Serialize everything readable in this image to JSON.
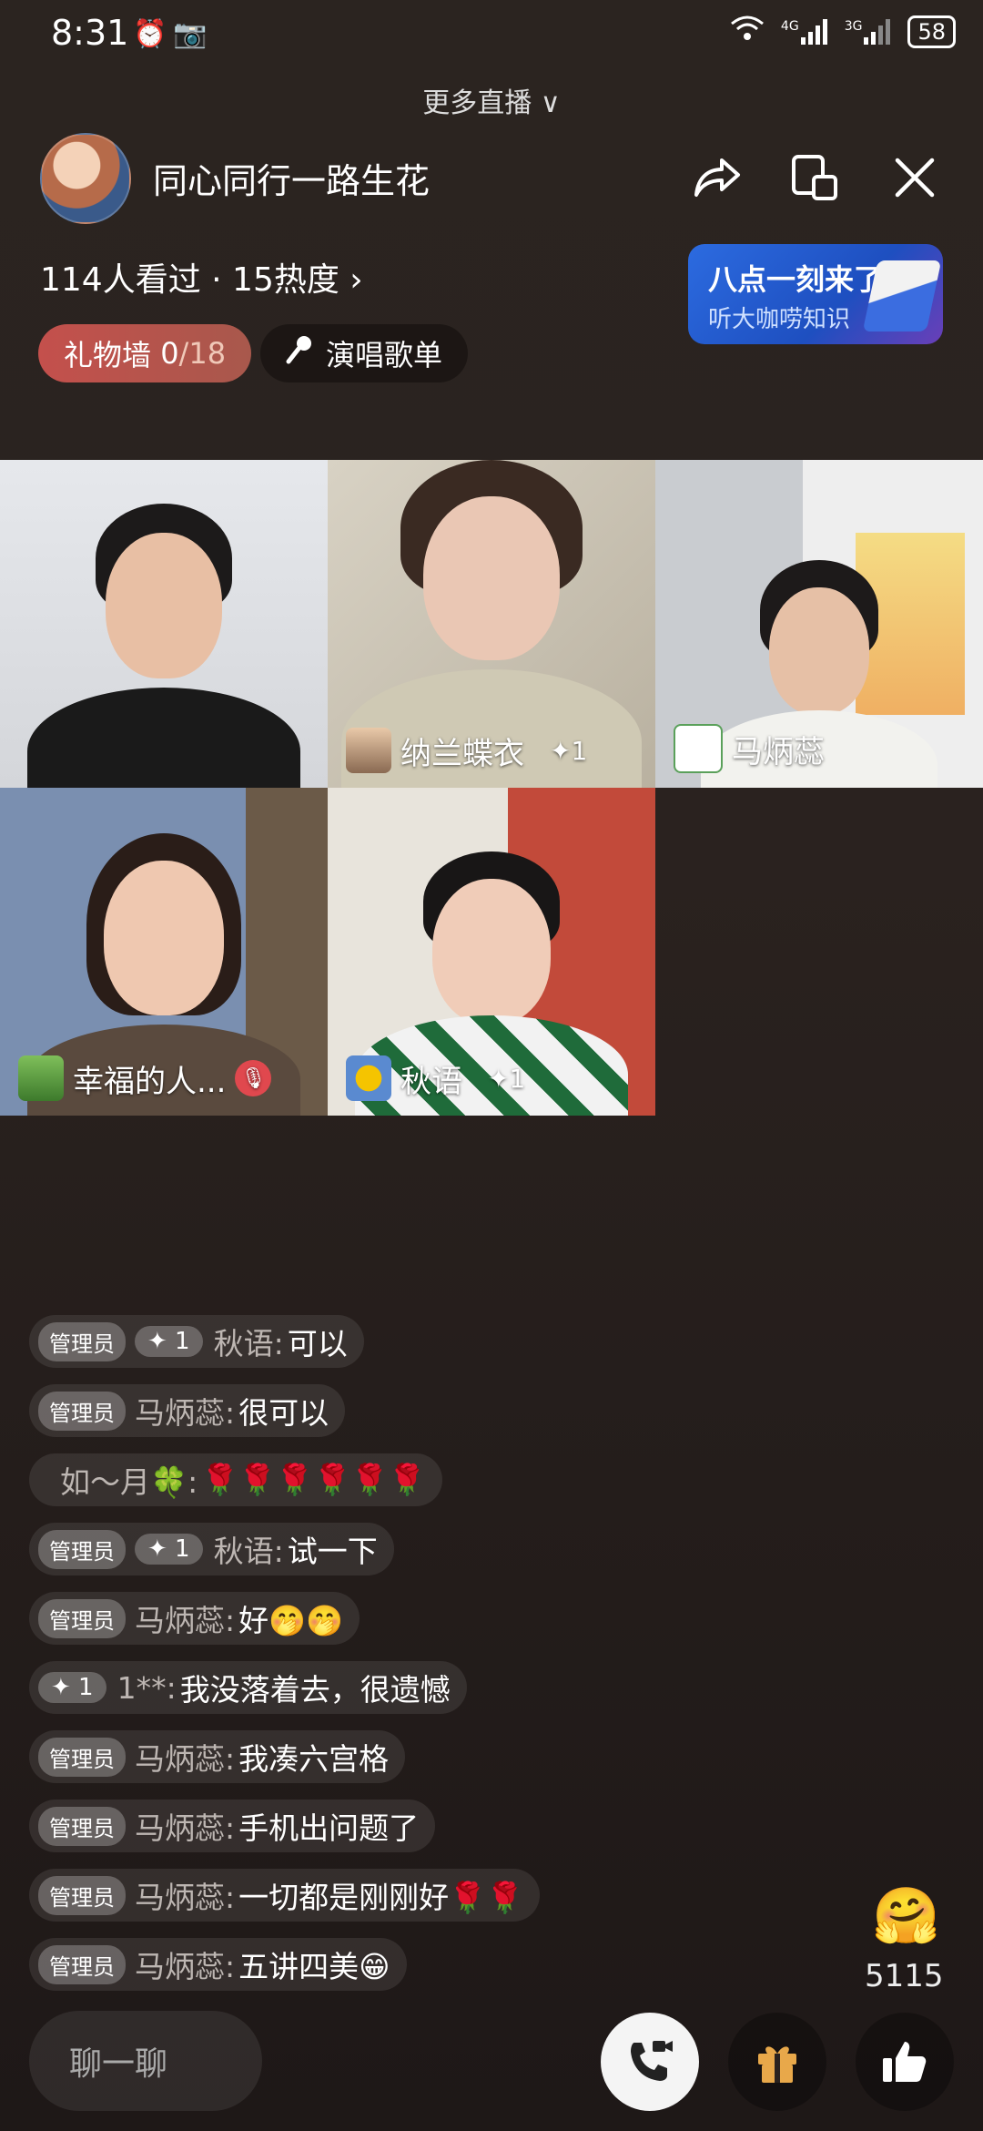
{
  "status_bar": {
    "time": "8:31",
    "network_1": "4G",
    "network_2": "3G",
    "battery": "58"
  },
  "header": {
    "more_live": "更多直播 ∨",
    "title": "同心同行一路生花",
    "viewers": "114人看过 · 15热度 ›"
  },
  "promo": {
    "line1": "八点一刻来了",
    "line2": "听大咖唠知识"
  },
  "pills": {
    "gift_wall_label": "礼物墙",
    "gift_wall_count": "0",
    "gift_wall_total": "/18",
    "songlist_label": "演唱歌单"
  },
  "tiles": [
    {
      "name": "",
      "plus": ""
    },
    {
      "name": "纳兰蝶衣",
      "plus": "✦1"
    },
    {
      "name": "马炳蕊",
      "plus": ""
    },
    {
      "name": "幸福的人...",
      "plus": ""
    },
    {
      "name": "秋语",
      "plus": "✦1"
    }
  ],
  "comments": [
    {
      "admin": "管理员",
      "level": "✦ 1",
      "user": "秋语:",
      "msg": "可以"
    },
    {
      "admin": "管理员",
      "level": "",
      "user": "马炳蕊:",
      "msg": "很可以"
    },
    {
      "admin": "",
      "level": "",
      "user": "如～月🍀:",
      "msg": "🌹🌹🌹🌹🌹🌹"
    },
    {
      "admin": "管理员",
      "level": "✦ 1",
      "user": "秋语:",
      "msg": "试一下"
    },
    {
      "admin": "管理员",
      "level": "",
      "user": "马炳蕊:",
      "msg": "好🤭🤭"
    },
    {
      "admin": "",
      "level": "✦ 1",
      "user": "1**:",
      "msg": "我没落着去，很遗憾"
    },
    {
      "admin": "管理员",
      "level": "",
      "user": "马炳蕊:",
      "msg": "我凑六宫格"
    },
    {
      "admin": "管理员",
      "level": "",
      "user": "马炳蕊:",
      "msg": "手机出问题了"
    },
    {
      "admin": "管理员",
      "level": "",
      "user": "马炳蕊:",
      "msg": "一切都是刚刚好🌹🌹"
    },
    {
      "admin": "管理员",
      "level": "",
      "user": "马炳蕊:",
      "msg": "五讲四美😁"
    }
  ],
  "bottom": {
    "chat_placeholder": "聊一聊",
    "like_count": "5115"
  },
  "colors": {
    "gift_wall": "#c4504c",
    "promo": "#2c6be0",
    "mute": "#e0484e"
  }
}
